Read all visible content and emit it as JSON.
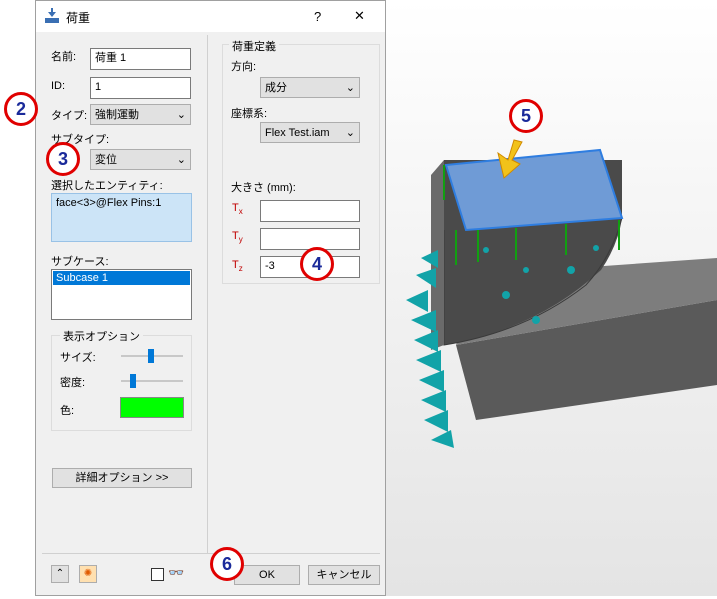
{
  "window": {
    "title": "荷重",
    "help": "?",
    "close": "✕"
  },
  "form": {
    "name_label": "名前:",
    "name_value": "荷重 1",
    "id_label": "ID:",
    "id_value": "1",
    "type_label": "タイプ:",
    "type_value": "強制運動",
    "subtype_label": "サブタイプ:",
    "subtype_value": "変位",
    "entity_label": "選択したエンティティ:",
    "entity_value": "face<3>@Flex Pins:1",
    "subcase_label": "サブケース:",
    "subcase_items": [
      "Subcase 1"
    ]
  },
  "display": {
    "group_label": "表示オプション",
    "size_label": "サイズ:",
    "size_level": 0.47,
    "density_label": "密度:",
    "density_level": 0.19,
    "color_label": "色:",
    "color_value": "#00ff00"
  },
  "advanced_button": "詳細オプション >>",
  "load_def": {
    "group_label": "荷重定義",
    "direction_label": "方向:",
    "direction_value": "成分",
    "coord_label": "座標系:",
    "coord_value": "Flex Test.iam",
    "magnitude_label": "大きさ (mm):",
    "tx_label": "T",
    "tx_sub": "x",
    "tx_value": "",
    "ty_label": "T",
    "ty_sub": "y",
    "ty_value": "",
    "tz_label": "T",
    "tz_sub": "z",
    "tz_value": "-3"
  },
  "footer": {
    "ok": "OK",
    "cancel": "キャンセル"
  },
  "callouts": [
    "2",
    "3",
    "4",
    "5",
    "6"
  ],
  "colors": {
    "callout_ring": "#e00000",
    "callout_text": "#1a2a9a",
    "face_highlight": "#6f9bd6",
    "load_color": "#00aaaa"
  },
  "icons": [
    "load-icon",
    "collapse-icon",
    "highlight-icon",
    "glasses-icon"
  ]
}
